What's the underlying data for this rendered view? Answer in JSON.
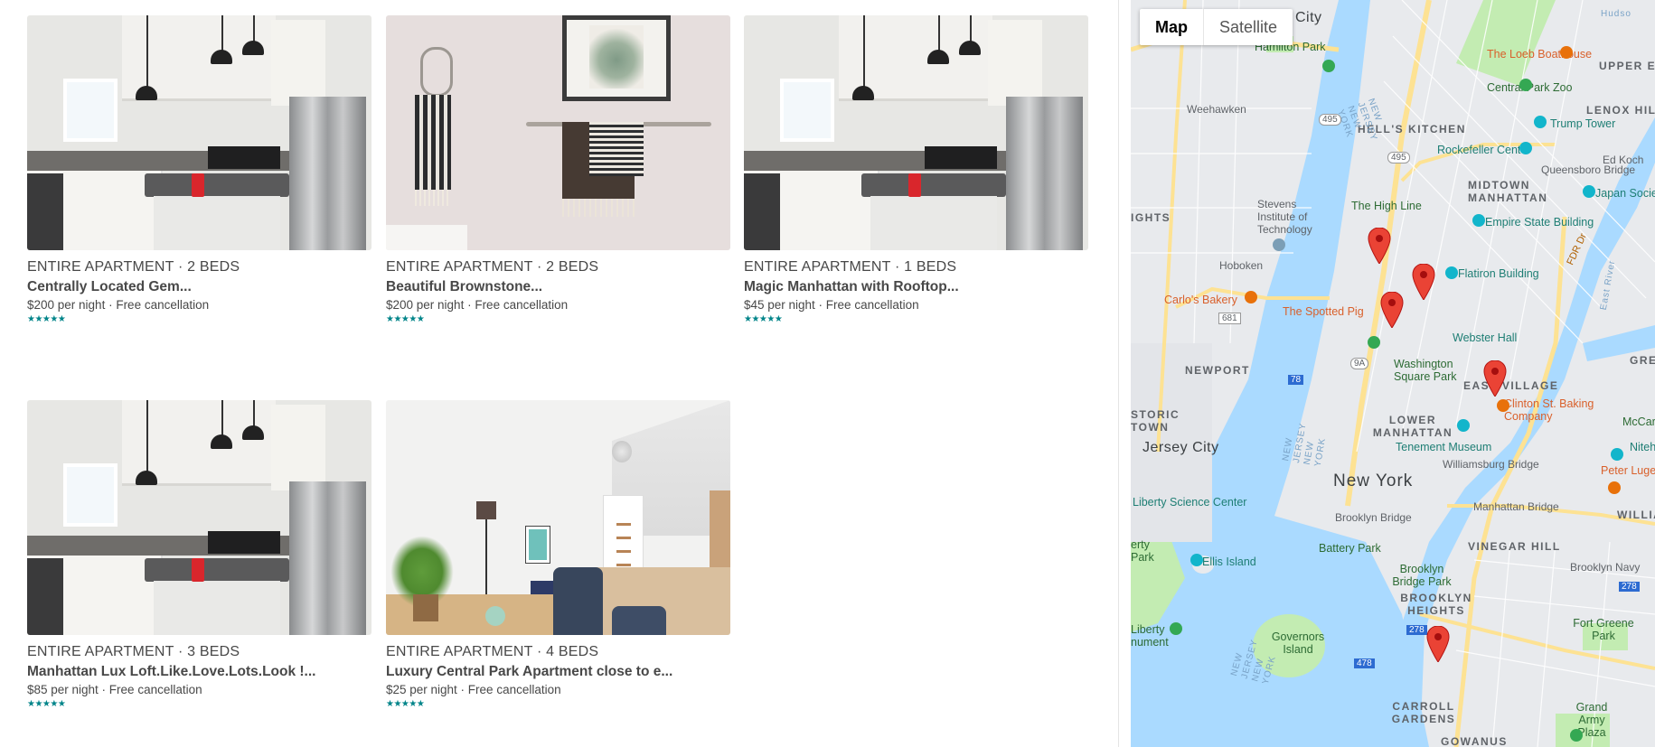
{
  "listings": [
    {
      "meta": "ENTIRE APARTMENT · 2 BEDS",
      "title": "Centrally Located Gem...",
      "price": "$200 per night · Free cancellation",
      "stars": "★★★★★",
      "photo": "kitchen-photo"
    },
    {
      "meta": "ENTIRE APARTMENT · 2 BEDS",
      "title": "Beautiful Brownstone...",
      "price": "$200 per night · Free cancellation",
      "stars": "★★★★★",
      "photo": "towels-photo"
    },
    {
      "meta": "ENTIRE APARTMENT · 1 BEDS",
      "title": "Magic Manhattan with Rooftop...",
      "price": "$45 per night · Free cancellation",
      "stars": "★★★★★",
      "photo": "kitchen-photo"
    },
    {
      "meta": "ENTIRE APARTMENT · 3 BEDS",
      "title": "Manhattan Lux Loft.Like.Love.Lots.Look !...",
      "price": "$85 per night · Free cancellation",
      "stars": "★★★★★",
      "photo": "kitchen-photo"
    },
    {
      "meta": "ENTIRE APARTMENT · 4 BEDS",
      "title": "Luxury Central Park Apartment close to e...",
      "price": "$25 per night · Free cancellation",
      "stars": "★★★★★",
      "photo": "bedroom-photo"
    }
  ],
  "map": {
    "toggle": {
      "map": "Map",
      "satellite": "Satellite"
    },
    "labels": {
      "city": "City",
      "hamilton_park": "Hamilton Park",
      "loeb": "The Loeb Boathouse",
      "weehawken": "Weehawken",
      "central_park_zoo": "Central Park Zoo",
      "lenox_hill": "LENOX HILL",
      "upper_east": "UPPER EAST S",
      "hells_kitchen": "HELL'S KITCHEN",
      "trump_tower": "Trump Tower",
      "rockefeller": "Rockefeller Center",
      "queensboro": "Queensboro Bridge",
      "ed_koch": "Ed Koch",
      "midtown": "MIDTOWN MANHATTAN",
      "japan_society": "Japan Socie",
      "high_line": "The High Line",
      "stevens": "Stevens Institute of Technology",
      "empire_state": "Empire State Building",
      "hoboken": "Hoboken",
      "flatiron": "Flatiron Building",
      "carlos": "Carlo's Bakery",
      "spotted_pig": "The Spotted Pig",
      "webster": "Webster Hall",
      "newport": "NEWPORT",
      "washington_sq": "Washington Square Park",
      "east_village": "EAST VILLAGE",
      "clinton_st": "Clinton St. Baking Company",
      "historic": "STORIC TOWN",
      "lower_manhattan": "LOWER MANHATTAN",
      "tenement": "Tenement Museum",
      "jersey_city": "Jersey City",
      "williamsburg_bridge": "Williamsburg Bridge",
      "peter_luger": "Peter Luger",
      "new_york": "New York",
      "williams": "WILLIAMS",
      "liberty_science": "Liberty Science Center",
      "brooklyn_bridge": "Brooklyn Bridge",
      "manhattan_bridge": "Manhattan Bridge",
      "battery_park": "Battery Park",
      "vinegar_hill": "VINEGAR HILL",
      "ellis_island": "Ellis Island",
      "liberty_state_park": "erty Park",
      "brooklyn_bridge_park": "Brooklyn Bridge Park",
      "brooklyn_navy": "Brooklyn Navy",
      "brooklyn_heights": "BROOKLYN HEIGHTS",
      "governors": "Governors Island",
      "fort_greene": "Fort Greene Park",
      "liberty_monument": "Liberty nument",
      "carroll_gardens": "CARROLL GARDENS",
      "grand_army": "Grand Army Plaza",
      "gowanus": "GOWANUS",
      "mccarren": "McCarr",
      "nitehawk": "Niteha",
      "hudson1": "NEW JERSEY NEW YORK",
      "hudson2": "NEW JERSEY NEW YORK",
      "hudson3": "NEW JERSEY NEW YORK",
      "east_river": "East River",
      "fdr": "FDR Dr",
      "r495": "495",
      "r495b": "495",
      "r681": "681",
      "r278": "278",
      "r278b": "278",
      "r478": "478",
      "r9a": "9A",
      "r78": "78",
      "ights": "IGHTS",
      "grea": "GREE",
      "hudson_short": "Hudso"
    }
  }
}
